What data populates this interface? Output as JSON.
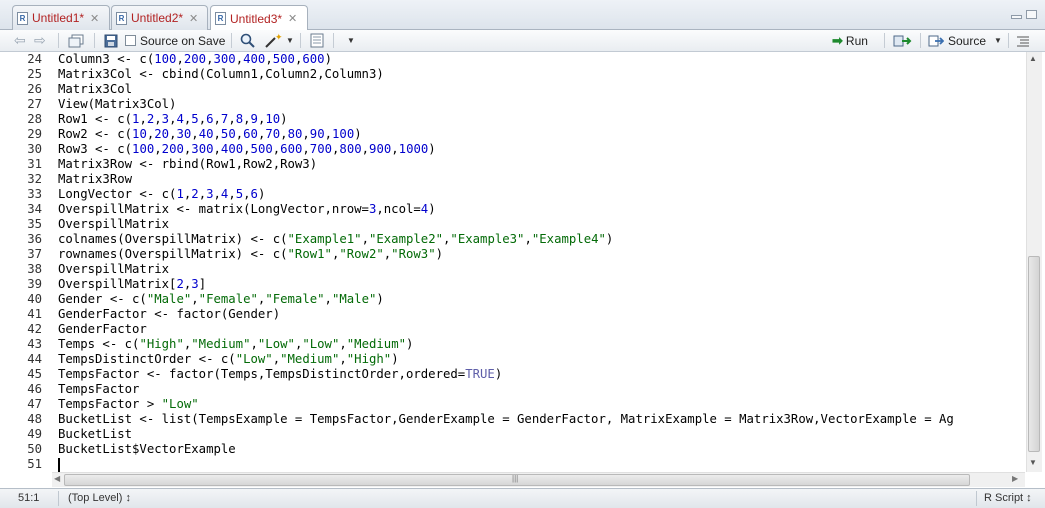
{
  "tabs": [
    {
      "label": "Untitled1*",
      "active": false
    },
    {
      "label": "Untitled2*",
      "active": false
    },
    {
      "label": "Untitled3*",
      "active": true
    }
  ],
  "toolbar": {
    "source_on_save": "Source on Save",
    "run": "Run",
    "source": "Source"
  },
  "editor": {
    "line_numbers": [
      "24",
      "25",
      "26",
      "27",
      "28",
      "29",
      "30",
      "31",
      "32",
      "33",
      "34",
      "35",
      "36",
      "37",
      "38",
      "39",
      "40",
      "41",
      "42",
      "43",
      "44",
      "45",
      "46",
      "47",
      "48",
      "49",
      "50",
      "51"
    ],
    "lines": [
      [
        [
          "t",
          "Column3 <- c("
        ],
        [
          "n",
          "100"
        ],
        [
          "t",
          ","
        ],
        [
          "n",
          "200"
        ],
        [
          "t",
          ","
        ],
        [
          "n",
          "300"
        ],
        [
          "t",
          ","
        ],
        [
          "n",
          "400"
        ],
        [
          "t",
          ","
        ],
        [
          "n",
          "500"
        ],
        [
          "t",
          ","
        ],
        [
          "n",
          "600"
        ],
        [
          "t",
          ")"
        ]
      ],
      [
        [
          "t",
          "Matrix3Col <- cbind(Column1,Column2,Column3)"
        ]
      ],
      [
        [
          "t",
          "Matrix3Col"
        ]
      ],
      [
        [
          "t",
          "View(Matrix3Col)"
        ]
      ],
      [
        [
          "t",
          "Row1 <- c("
        ],
        [
          "n",
          "1"
        ],
        [
          "t",
          ","
        ],
        [
          "n",
          "2"
        ],
        [
          "t",
          ","
        ],
        [
          "n",
          "3"
        ],
        [
          "t",
          ","
        ],
        [
          "n",
          "4"
        ],
        [
          "t",
          ","
        ],
        [
          "n",
          "5"
        ],
        [
          "t",
          ","
        ],
        [
          "n",
          "6"
        ],
        [
          "t",
          ","
        ],
        [
          "n",
          "7"
        ],
        [
          "t",
          ","
        ],
        [
          "n",
          "8"
        ],
        [
          "t",
          ","
        ],
        [
          "n",
          "9"
        ],
        [
          "t",
          ","
        ],
        [
          "n",
          "10"
        ],
        [
          "t",
          ")"
        ]
      ],
      [
        [
          "t",
          "Row2 <- c("
        ],
        [
          "n",
          "10"
        ],
        [
          "t",
          ","
        ],
        [
          "n",
          "20"
        ],
        [
          "t",
          ","
        ],
        [
          "n",
          "30"
        ],
        [
          "t",
          ","
        ],
        [
          "n",
          "40"
        ],
        [
          "t",
          ","
        ],
        [
          "n",
          "50"
        ],
        [
          "t",
          ","
        ],
        [
          "n",
          "60"
        ],
        [
          "t",
          ","
        ],
        [
          "n",
          "70"
        ],
        [
          "t",
          ","
        ],
        [
          "n",
          "80"
        ],
        [
          "t",
          ","
        ],
        [
          "n",
          "90"
        ],
        [
          "t",
          ","
        ],
        [
          "n",
          "100"
        ],
        [
          "t",
          ")"
        ]
      ],
      [
        [
          "t",
          "Row3 <- c("
        ],
        [
          "n",
          "100"
        ],
        [
          "t",
          ","
        ],
        [
          "n",
          "200"
        ],
        [
          "t",
          ","
        ],
        [
          "n",
          "300"
        ],
        [
          "t",
          ","
        ],
        [
          "n",
          "400"
        ],
        [
          "t",
          ","
        ],
        [
          "n",
          "500"
        ],
        [
          "t",
          ","
        ],
        [
          "n",
          "600"
        ],
        [
          "t",
          ","
        ],
        [
          "n",
          "700"
        ],
        [
          "t",
          ","
        ],
        [
          "n",
          "800"
        ],
        [
          "t",
          ","
        ],
        [
          "n",
          "900"
        ],
        [
          "t",
          ","
        ],
        [
          "n",
          "1000"
        ],
        [
          "t",
          ")"
        ]
      ],
      [
        [
          "t",
          "Matrix3Row <- rbind(Row1,Row2,Row3)"
        ]
      ],
      [
        [
          "t",
          "Matrix3Row"
        ]
      ],
      [
        [
          "t",
          "LongVector <- c("
        ],
        [
          "n",
          "1"
        ],
        [
          "t",
          ","
        ],
        [
          "n",
          "2"
        ],
        [
          "t",
          ","
        ],
        [
          "n",
          "3"
        ],
        [
          "t",
          ","
        ],
        [
          "n",
          "4"
        ],
        [
          "t",
          ","
        ],
        [
          "n",
          "5"
        ],
        [
          "t",
          ","
        ],
        [
          "n",
          "6"
        ],
        [
          "t",
          ")"
        ]
      ],
      [
        [
          "t",
          "OverspillMatrix <- matrix(LongVector,nrow="
        ],
        [
          "n",
          "3"
        ],
        [
          "t",
          ",ncol="
        ],
        [
          "n",
          "4"
        ],
        [
          "t",
          ")"
        ]
      ],
      [
        [
          "t",
          "OverspillMatrix"
        ]
      ],
      [
        [
          "t",
          "colnames(OverspillMatrix) <- c("
        ],
        [
          "s",
          "\"Example1\""
        ],
        [
          "t",
          ","
        ],
        [
          "s",
          "\"Example2\""
        ],
        [
          "t",
          ","
        ],
        [
          "s",
          "\"Example3\""
        ],
        [
          "t",
          ","
        ],
        [
          "s",
          "\"Example4\""
        ],
        [
          "t",
          ")"
        ]
      ],
      [
        [
          "t",
          "rownames(OverspillMatrix) <- c("
        ],
        [
          "s",
          "\"Row1\""
        ],
        [
          "t",
          ","
        ],
        [
          "s",
          "\"Row2\""
        ],
        [
          "t",
          ","
        ],
        [
          "s",
          "\"Row3\""
        ],
        [
          "t",
          ")"
        ]
      ],
      [
        [
          "t",
          "OverspillMatrix"
        ]
      ],
      [
        [
          "t",
          "OverspillMatrix["
        ],
        [
          "n",
          "2"
        ],
        [
          "t",
          ","
        ],
        [
          "n",
          "3"
        ],
        [
          "t",
          "]"
        ]
      ],
      [
        [
          "t",
          "Gender <- c("
        ],
        [
          "s",
          "\"Male\""
        ],
        [
          "t",
          ","
        ],
        [
          "s",
          "\"Female\""
        ],
        [
          "t",
          ","
        ],
        [
          "s",
          "\"Female\""
        ],
        [
          "t",
          ","
        ],
        [
          "s",
          "\"Male\""
        ],
        [
          "t",
          ")"
        ]
      ],
      [
        [
          "t",
          "GenderFactor <- factor(Gender)"
        ]
      ],
      [
        [
          "t",
          "GenderFactor"
        ]
      ],
      [
        [
          "t",
          "Temps <- c("
        ],
        [
          "s",
          "\"High\""
        ],
        [
          "t",
          ","
        ],
        [
          "s",
          "\"Medium\""
        ],
        [
          "t",
          ","
        ],
        [
          "s",
          "\"Low\""
        ],
        [
          "t",
          ","
        ],
        [
          "s",
          "\"Low\""
        ],
        [
          "t",
          ","
        ],
        [
          "s",
          "\"Medium\""
        ],
        [
          "t",
          ")"
        ]
      ],
      [
        [
          "t",
          "TempsDistinctOrder <- c("
        ],
        [
          "s",
          "\"Low\""
        ],
        [
          "t",
          ","
        ],
        [
          "s",
          "\"Medium\""
        ],
        [
          "t",
          ","
        ],
        [
          "s",
          "\"High\""
        ],
        [
          "t",
          ")"
        ]
      ],
      [
        [
          "t",
          "TempsFactor <- factor(Temps,TempsDistinctOrder,ordered="
        ],
        [
          "k",
          "TRUE"
        ],
        [
          "t",
          ")"
        ]
      ],
      [
        [
          "t",
          "TempsFactor"
        ]
      ],
      [
        [
          "t",
          "TempsFactor > "
        ],
        [
          "s",
          "\"Low\""
        ]
      ],
      [
        [
          "t",
          "BucketList <- list(TempsExample = TempsFactor,GenderExample = GenderFactor, MatrixExample = Matrix3Row,VectorExample = Ag"
        ]
      ],
      [
        [
          "t",
          "BucketList"
        ]
      ],
      [
        [
          "t",
          "BucketList$VectorExample"
        ]
      ],
      []
    ]
  },
  "statusbar": {
    "position": "51:1",
    "scope": "(Top Level) ↕",
    "filetype": "R Script ↕"
  },
  "colors": {
    "number": "#0000cd",
    "string": "#036a07",
    "keyword": "#5e5ea8",
    "modified_tab": "#b22222"
  },
  "icons": [
    "back-icon",
    "forward-icon",
    "show-in-window-icon",
    "save-icon",
    "find-icon",
    "magic-wand-icon",
    "compile-report-icon",
    "run-arrow-icon",
    "rerun-icon",
    "source-icon",
    "outline-icon",
    "close-icon",
    "minimize-icon",
    "maximize-icon",
    "r-file-icon"
  ]
}
